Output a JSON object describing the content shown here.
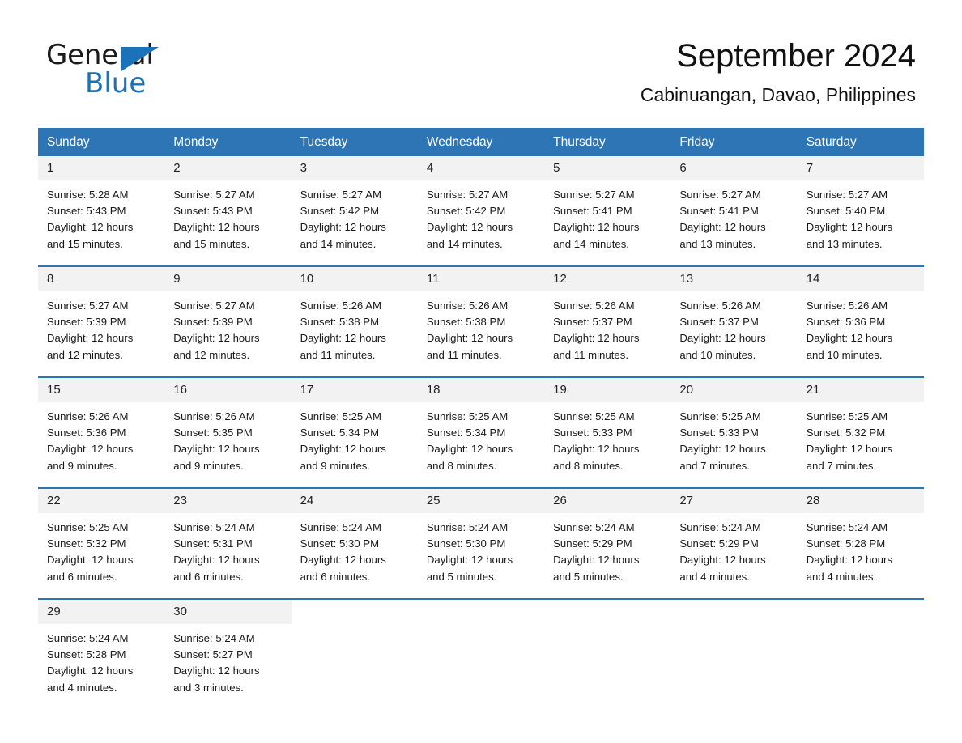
{
  "brand": {
    "name_part1": "General",
    "name_part2": "Blue",
    "accent_color": "#1b72b8"
  },
  "header": {
    "title": "September 2024",
    "location": "Cabinuangan, Davao, Philippines"
  },
  "theme": {
    "header_blue": "#2e75b6",
    "day_band_gray": "#f2f2f2",
    "text_color": "#1a1a1a"
  },
  "weekdays": [
    "Sunday",
    "Monday",
    "Tuesday",
    "Wednesday",
    "Thursday",
    "Friday",
    "Saturday"
  ],
  "labels": {
    "sunrise_prefix": "Sunrise:",
    "sunset_prefix": "Sunset:",
    "daylight_prefix": "Daylight:"
  },
  "weeks": [
    [
      {
        "day": "1",
        "sunrise": "Sunrise: 5:28 AM",
        "sunset": "Sunset: 5:43 PM",
        "daylight_line1": "Daylight: 12 hours",
        "daylight_line2": "and 15 minutes."
      },
      {
        "day": "2",
        "sunrise": "Sunrise: 5:27 AM",
        "sunset": "Sunset: 5:43 PM",
        "daylight_line1": "Daylight: 12 hours",
        "daylight_line2": "and 15 minutes."
      },
      {
        "day": "3",
        "sunrise": "Sunrise: 5:27 AM",
        "sunset": "Sunset: 5:42 PM",
        "daylight_line1": "Daylight: 12 hours",
        "daylight_line2": "and 14 minutes."
      },
      {
        "day": "4",
        "sunrise": "Sunrise: 5:27 AM",
        "sunset": "Sunset: 5:42 PM",
        "daylight_line1": "Daylight: 12 hours",
        "daylight_line2": "and 14 minutes."
      },
      {
        "day": "5",
        "sunrise": "Sunrise: 5:27 AM",
        "sunset": "Sunset: 5:41 PM",
        "daylight_line1": "Daylight: 12 hours",
        "daylight_line2": "and 14 minutes."
      },
      {
        "day": "6",
        "sunrise": "Sunrise: 5:27 AM",
        "sunset": "Sunset: 5:41 PM",
        "daylight_line1": "Daylight: 12 hours",
        "daylight_line2": "and 13 minutes."
      },
      {
        "day": "7",
        "sunrise": "Sunrise: 5:27 AM",
        "sunset": "Sunset: 5:40 PM",
        "daylight_line1": "Daylight: 12 hours",
        "daylight_line2": "and 13 minutes."
      }
    ],
    [
      {
        "day": "8",
        "sunrise": "Sunrise: 5:27 AM",
        "sunset": "Sunset: 5:39 PM",
        "daylight_line1": "Daylight: 12 hours",
        "daylight_line2": "and 12 minutes."
      },
      {
        "day": "9",
        "sunrise": "Sunrise: 5:27 AM",
        "sunset": "Sunset: 5:39 PM",
        "daylight_line1": "Daylight: 12 hours",
        "daylight_line2": "and 12 minutes."
      },
      {
        "day": "10",
        "sunrise": "Sunrise: 5:26 AM",
        "sunset": "Sunset: 5:38 PM",
        "daylight_line1": "Daylight: 12 hours",
        "daylight_line2": "and 11 minutes."
      },
      {
        "day": "11",
        "sunrise": "Sunrise: 5:26 AM",
        "sunset": "Sunset: 5:38 PM",
        "daylight_line1": "Daylight: 12 hours",
        "daylight_line2": "and 11 minutes."
      },
      {
        "day": "12",
        "sunrise": "Sunrise: 5:26 AM",
        "sunset": "Sunset: 5:37 PM",
        "daylight_line1": "Daylight: 12 hours",
        "daylight_line2": "and 11 minutes."
      },
      {
        "day": "13",
        "sunrise": "Sunrise: 5:26 AM",
        "sunset": "Sunset: 5:37 PM",
        "daylight_line1": "Daylight: 12 hours",
        "daylight_line2": "and 10 minutes."
      },
      {
        "day": "14",
        "sunrise": "Sunrise: 5:26 AM",
        "sunset": "Sunset: 5:36 PM",
        "daylight_line1": "Daylight: 12 hours",
        "daylight_line2": "and 10 minutes."
      }
    ],
    [
      {
        "day": "15",
        "sunrise": "Sunrise: 5:26 AM",
        "sunset": "Sunset: 5:36 PM",
        "daylight_line1": "Daylight: 12 hours",
        "daylight_line2": "and 9 minutes."
      },
      {
        "day": "16",
        "sunrise": "Sunrise: 5:26 AM",
        "sunset": "Sunset: 5:35 PM",
        "daylight_line1": "Daylight: 12 hours",
        "daylight_line2": "and 9 minutes."
      },
      {
        "day": "17",
        "sunrise": "Sunrise: 5:25 AM",
        "sunset": "Sunset: 5:34 PM",
        "daylight_line1": "Daylight: 12 hours",
        "daylight_line2": "and 9 minutes."
      },
      {
        "day": "18",
        "sunrise": "Sunrise: 5:25 AM",
        "sunset": "Sunset: 5:34 PM",
        "daylight_line1": "Daylight: 12 hours",
        "daylight_line2": "and 8 minutes."
      },
      {
        "day": "19",
        "sunrise": "Sunrise: 5:25 AM",
        "sunset": "Sunset: 5:33 PM",
        "daylight_line1": "Daylight: 12 hours",
        "daylight_line2": "and 8 minutes."
      },
      {
        "day": "20",
        "sunrise": "Sunrise: 5:25 AM",
        "sunset": "Sunset: 5:33 PM",
        "daylight_line1": "Daylight: 12 hours",
        "daylight_line2": "and 7 minutes."
      },
      {
        "day": "21",
        "sunrise": "Sunrise: 5:25 AM",
        "sunset": "Sunset: 5:32 PM",
        "daylight_line1": "Daylight: 12 hours",
        "daylight_line2": "and 7 minutes."
      }
    ],
    [
      {
        "day": "22",
        "sunrise": "Sunrise: 5:25 AM",
        "sunset": "Sunset: 5:32 PM",
        "daylight_line1": "Daylight: 12 hours",
        "daylight_line2": "and 6 minutes."
      },
      {
        "day": "23",
        "sunrise": "Sunrise: 5:24 AM",
        "sunset": "Sunset: 5:31 PM",
        "daylight_line1": "Daylight: 12 hours",
        "daylight_line2": "and 6 minutes."
      },
      {
        "day": "24",
        "sunrise": "Sunrise: 5:24 AM",
        "sunset": "Sunset: 5:30 PM",
        "daylight_line1": "Daylight: 12 hours",
        "daylight_line2": "and 6 minutes."
      },
      {
        "day": "25",
        "sunrise": "Sunrise: 5:24 AM",
        "sunset": "Sunset: 5:30 PM",
        "daylight_line1": "Daylight: 12 hours",
        "daylight_line2": "and 5 minutes."
      },
      {
        "day": "26",
        "sunrise": "Sunrise: 5:24 AM",
        "sunset": "Sunset: 5:29 PM",
        "daylight_line1": "Daylight: 12 hours",
        "daylight_line2": "and 5 minutes."
      },
      {
        "day": "27",
        "sunrise": "Sunrise: 5:24 AM",
        "sunset": "Sunset: 5:29 PM",
        "daylight_line1": "Daylight: 12 hours",
        "daylight_line2": "and 4 minutes."
      },
      {
        "day": "28",
        "sunrise": "Sunrise: 5:24 AM",
        "sunset": "Sunset: 5:28 PM",
        "daylight_line1": "Daylight: 12 hours",
        "daylight_line2": "and 4 minutes."
      }
    ],
    [
      {
        "day": "29",
        "sunrise": "Sunrise: 5:24 AM",
        "sunset": "Sunset: 5:28 PM",
        "daylight_line1": "Daylight: 12 hours",
        "daylight_line2": "and 4 minutes."
      },
      {
        "day": "30",
        "sunrise": "Sunrise: 5:24 AM",
        "sunset": "Sunset: 5:27 PM",
        "daylight_line1": "Daylight: 12 hours",
        "daylight_line2": "and 3 minutes."
      },
      {
        "day": "",
        "sunrise": "",
        "sunset": "",
        "daylight_line1": "",
        "daylight_line2": ""
      },
      {
        "day": "",
        "sunrise": "",
        "sunset": "",
        "daylight_line1": "",
        "daylight_line2": ""
      },
      {
        "day": "",
        "sunrise": "",
        "sunset": "",
        "daylight_line1": "",
        "daylight_line2": ""
      },
      {
        "day": "",
        "sunrise": "",
        "sunset": "",
        "daylight_line1": "",
        "daylight_line2": ""
      },
      {
        "day": "",
        "sunrise": "",
        "sunset": "",
        "daylight_line1": "",
        "daylight_line2": ""
      }
    ]
  ]
}
